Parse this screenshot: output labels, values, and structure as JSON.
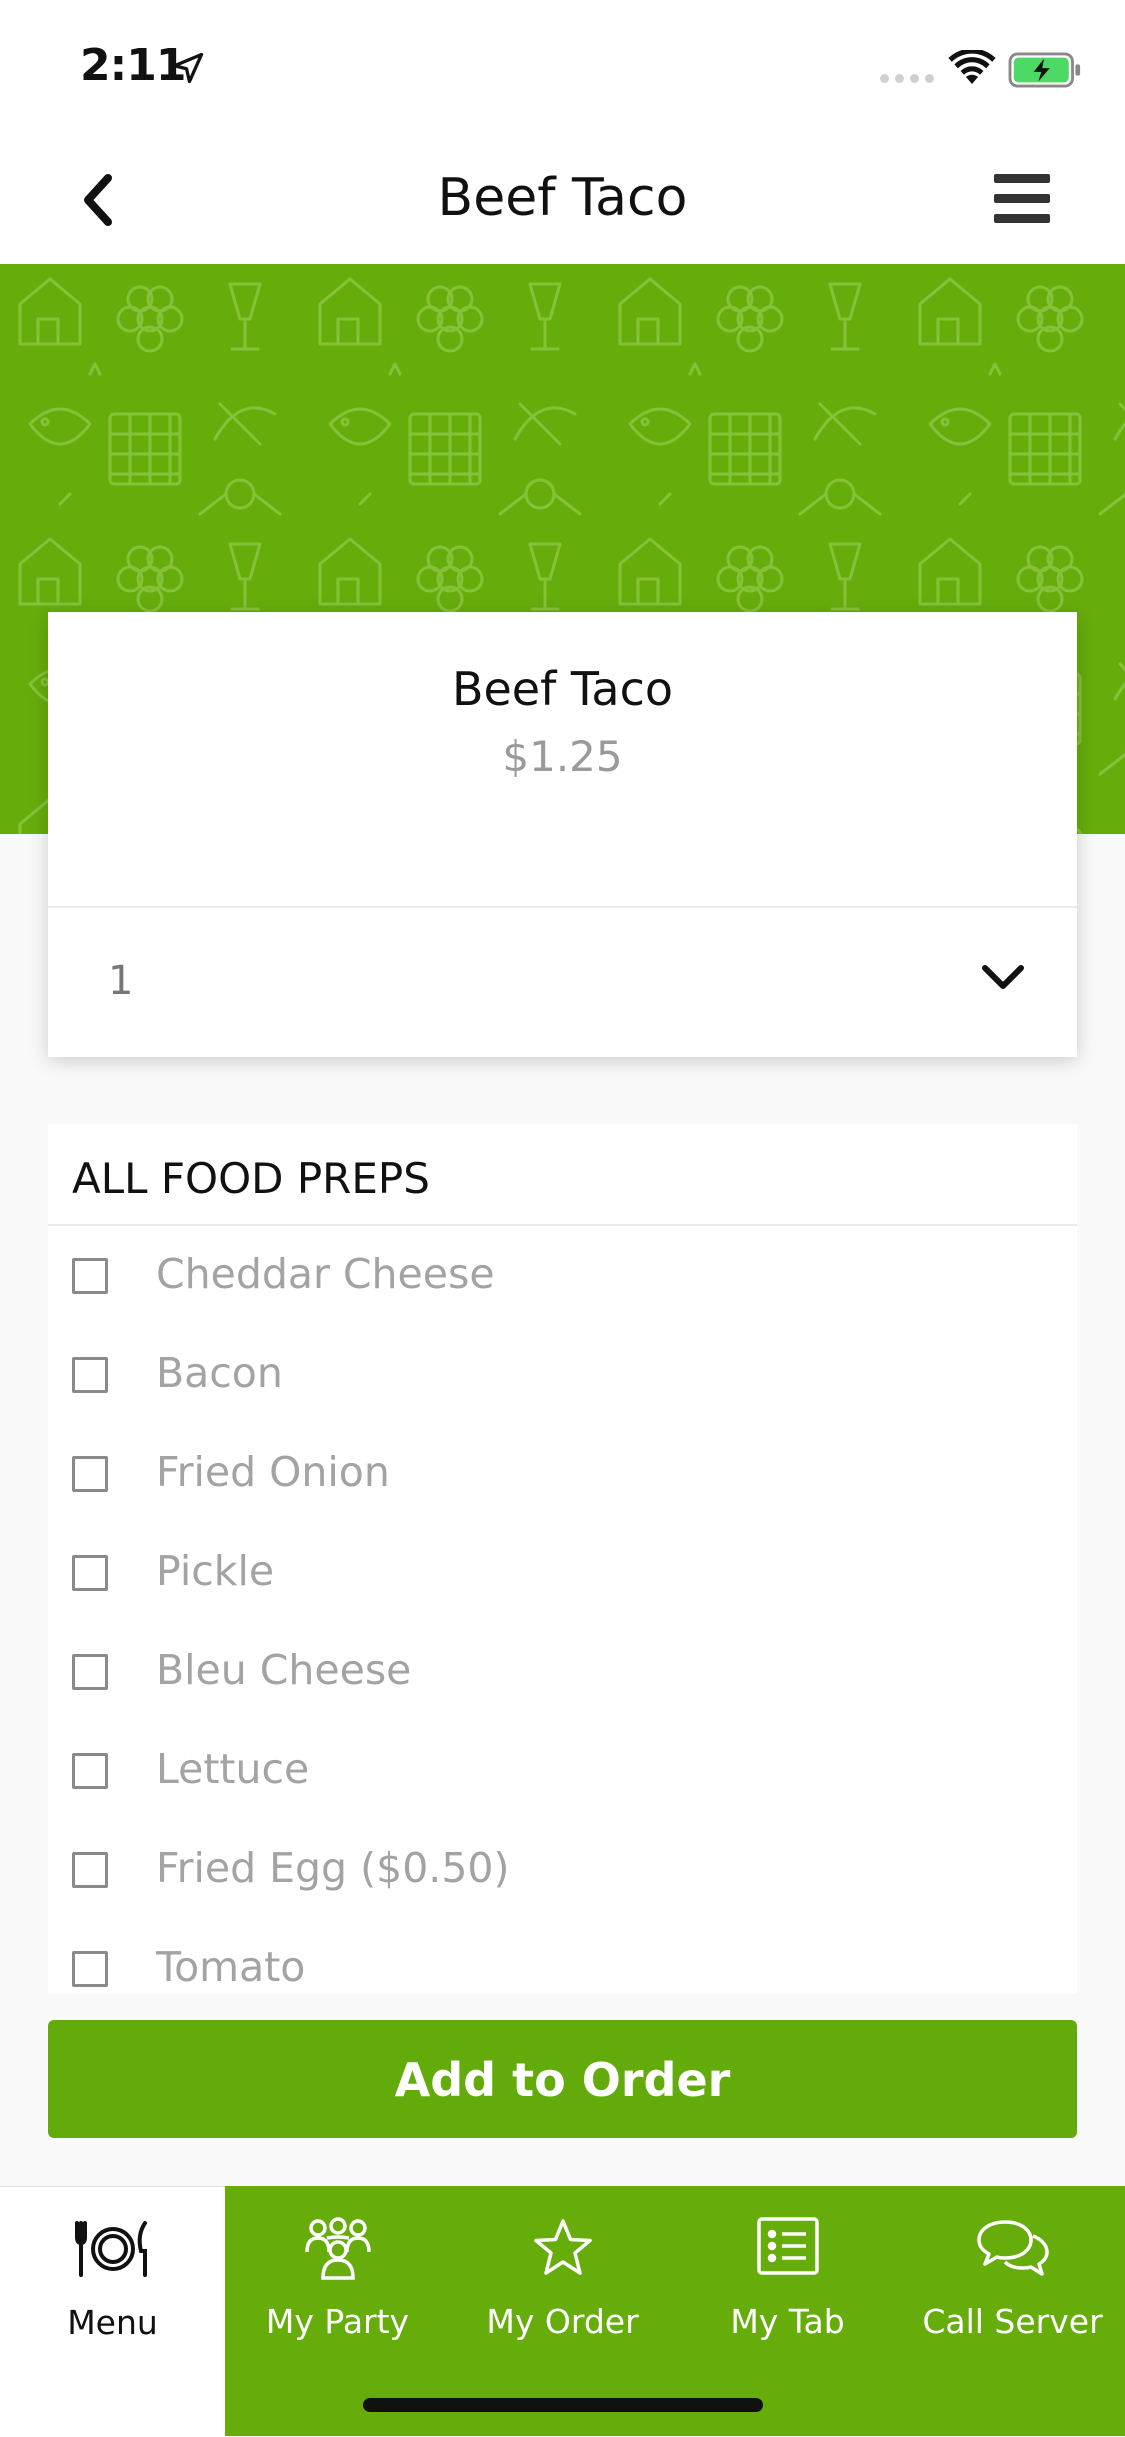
{
  "status_bar": {
    "time": "2:11"
  },
  "nav": {
    "title": "Beef Taco"
  },
  "item": {
    "name": "Beef Taco",
    "price": "$1.25",
    "quantity": "1"
  },
  "preps": {
    "title": "ALL FOOD PREPS",
    "items": [
      {
        "label": "Cheddar Cheese",
        "checked": false
      },
      {
        "label": "Bacon",
        "checked": false
      },
      {
        "label": "Fried Onion",
        "checked": false
      },
      {
        "label": "Pickle",
        "checked": false
      },
      {
        "label": "Bleu Cheese",
        "checked": false
      },
      {
        "label": "Lettuce",
        "checked": false
      },
      {
        "label": "Fried Egg ($0.50)",
        "checked": false
      },
      {
        "label": "Tomato",
        "checked": false
      }
    ]
  },
  "actions": {
    "add_label": "Add to Order"
  },
  "tabs": [
    {
      "label": "Menu",
      "icon": "plate-cutlery-icon",
      "active": true
    },
    {
      "label": "My Party",
      "icon": "group-icon",
      "active": false
    },
    {
      "label": "My Order",
      "icon": "star-icon",
      "active": false
    },
    {
      "label": "My Tab",
      "icon": "list-icon",
      "active": false
    },
    {
      "label": "Call Server",
      "icon": "chat-bubbles-icon",
      "active": false
    }
  ],
  "colors": {
    "brand_green": "#66ad0b",
    "button_green": "#63ab0a",
    "battery_green": "#4cd964"
  }
}
